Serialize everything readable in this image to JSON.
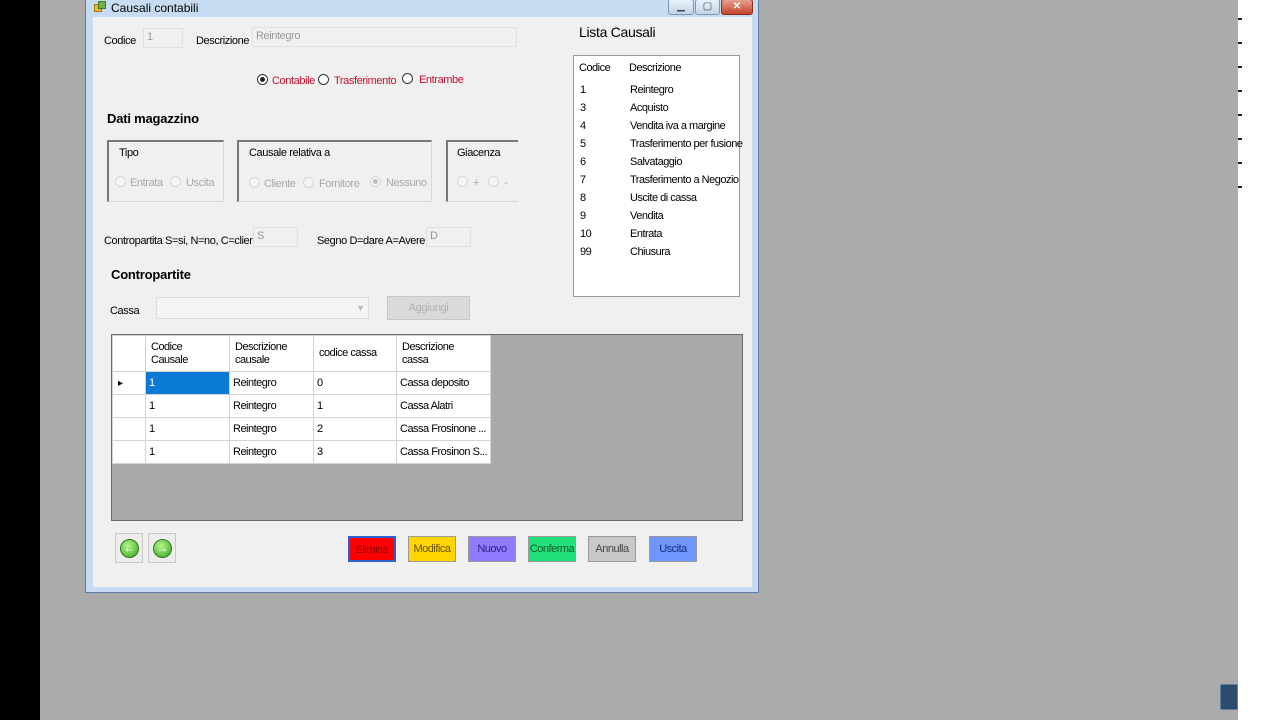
{
  "window": {
    "title": "Causali contabili"
  },
  "form": {
    "codice_label": "Codice",
    "codice_value": "1",
    "descrizione_label": "Descrizione",
    "descrizione_value": "Reintegro",
    "type_options": [
      {
        "label": "Contabile",
        "checked": true
      },
      {
        "label": "Trasferimento",
        "checked": false
      },
      {
        "label": "Entrambe",
        "checked": false
      }
    ]
  },
  "magazzino": {
    "section_title": "Dati magazzino",
    "tipo": {
      "title": "Tipo",
      "options": [
        "Entrata",
        "Uscita"
      ]
    },
    "causale_relativa": {
      "title": "Causale relativa a",
      "options": [
        "Cliente",
        "Fornitore",
        "Nessuno"
      ],
      "selected": "Nessuno"
    },
    "giacenza": {
      "title": "Giacenza",
      "options": [
        "+",
        "-"
      ]
    },
    "contropartita_label": "Contropartita S=si, N=no, C=cliente",
    "contropartita_value": "S",
    "segno_label": "Segno D=dare A=Avere",
    "segno_value": "D"
  },
  "contropartite": {
    "section_title": "Contropartite",
    "cassa_label": "Cassa",
    "cassa_value": "",
    "aggiungi_label": "Aggiungi",
    "columns": [
      "Codice\nCausale",
      "Descrizione\ncausale",
      "codice cassa",
      "Descrizione\ncassa"
    ],
    "rows": [
      [
        "1",
        "Reintegro",
        "0",
        "Cassa deposito"
      ],
      [
        "1",
        "Reintegro",
        "1",
        "Cassa Alatri"
      ],
      [
        "1",
        "Reintegro",
        "2",
        "Cassa Frosinone ..."
      ],
      [
        "1",
        "Reintegro",
        "3",
        "Cassa Frosinon S..."
      ]
    ]
  },
  "lista": {
    "title": "Lista Causali",
    "header_codice": "Codice",
    "header_descrizione": "Descrizione",
    "items": [
      {
        "codice": "1",
        "descrizione": "Reintegro"
      },
      {
        "codice": "3",
        "descrizione": "Acquisto"
      },
      {
        "codice": "4",
        "descrizione": "Vendita iva a margine"
      },
      {
        "codice": "5",
        "descrizione": "Trasferimento per fusione"
      },
      {
        "codice": "6",
        "descrizione": "Salvataggio"
      },
      {
        "codice": "7",
        "descrizione": "Trasferimento a Negozio"
      },
      {
        "codice": "8",
        "descrizione": "Uscite di cassa"
      },
      {
        "codice": "9",
        "descrizione": "Vendita"
      },
      {
        "codice": "10",
        "descrizione": "Entrata"
      },
      {
        "codice": "99",
        "descrizione": "Chiusura"
      }
    ]
  },
  "actions": [
    {
      "label": "Elimina",
      "color": "#ff0000",
      "text_color": "#8a0000"
    },
    {
      "label": "Modifica",
      "color": "#ffd400",
      "text_color": "#6a5400"
    },
    {
      "label": "Nuovo",
      "color": "#8f7bff",
      "text_color": "#2b1f80"
    },
    {
      "label": "Conferma",
      "color": "#22e07a",
      "text_color": "#0b5a2e"
    },
    {
      "label": "Annulla",
      "color": "#c8c8c8",
      "text_color": "#444444"
    },
    {
      "label": "Uscita",
      "color": "#6f95ff",
      "text_color": "#13327a"
    }
  ],
  "nav": {
    "prev_icon": "arrow-left-icon",
    "next_icon": "arrow-right-icon"
  }
}
